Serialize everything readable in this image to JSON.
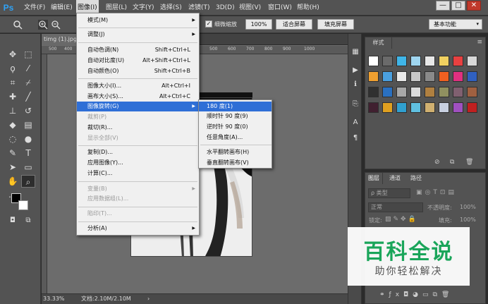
{
  "app": {
    "logo": "Ps"
  },
  "menubar": {
    "items": [
      "文件(F)",
      "编辑(E)",
      "图像(I)",
      "图层(L)",
      "文字(Y)",
      "选择(S)",
      "滤镜(T)",
      "3D(D)",
      "视图(V)",
      "窗口(W)",
      "帮助(H)"
    ],
    "active_index": 2,
    "window_controls": [
      "—",
      "□",
      "✕"
    ]
  },
  "options_bar": {
    "fine_scrub_label": "细微缩放",
    "zoom_value": "100%",
    "fit_screen_label": "适合屏幕",
    "fill_screen_label": "填充屏幕",
    "workspace_value": "基本功能"
  },
  "document": {
    "tab_title": "timg (1).jpg",
    "ruler_ticks": [
      "500",
      "400",
      "300",
      "200",
      "100",
      "0",
      "500",
      "600",
      "700",
      "800",
      "900",
      "1000"
    ],
    "zoom_status": "33.33%",
    "doc_info": "文档:2.10M/2.10M",
    "status_arrow": "›"
  },
  "image_menu": {
    "items": [
      {
        "label": "模式(M)",
        "shortcut": "",
        "submenu": true,
        "disabled": false
      },
      {
        "label": "调整(J)",
        "shortcut": "",
        "submenu": true,
        "disabled": false
      },
      {
        "label": "自动色调(N)",
        "shortcut": "Shift+Ctrl+L",
        "submenu": false,
        "disabled": false
      },
      {
        "label": "自动对比度(U)",
        "shortcut": "Alt+Shift+Ctrl+L",
        "submenu": false,
        "disabled": false
      },
      {
        "label": "自动颜色(O)",
        "shortcut": "Shift+Ctrl+B",
        "submenu": false,
        "disabled": false
      },
      {
        "label": "图像大小(I)...",
        "shortcut": "Alt+Ctrl+I",
        "submenu": false,
        "disabled": false
      },
      {
        "label": "画布大小(S)...",
        "shortcut": "Alt+Ctrl+C",
        "submenu": false,
        "disabled": false
      },
      {
        "label": "图像旋转(G)",
        "shortcut": "",
        "submenu": true,
        "disabled": false,
        "highlighted": true
      },
      {
        "label": "裁剪(P)",
        "shortcut": "",
        "submenu": false,
        "disabled": true
      },
      {
        "label": "裁切(R)...",
        "shortcut": "",
        "submenu": false,
        "disabled": false
      },
      {
        "label": "显示全部(V)",
        "shortcut": "",
        "submenu": false,
        "disabled": true
      },
      {
        "label": "复制(D)...",
        "shortcut": "",
        "submenu": false,
        "disabled": false
      },
      {
        "label": "应用图像(Y)...",
        "shortcut": "",
        "submenu": false,
        "disabled": false
      },
      {
        "label": "计算(C)...",
        "shortcut": "",
        "submenu": false,
        "disabled": false
      },
      {
        "label": "变量(B)",
        "shortcut": "",
        "submenu": true,
        "disabled": true
      },
      {
        "label": "应用数据组(L)...",
        "shortcut": "",
        "submenu": false,
        "disabled": true
      },
      {
        "label": "陷印(T)...",
        "shortcut": "",
        "submenu": false,
        "disabled": true
      },
      {
        "label": "分析(A)",
        "shortcut": "",
        "submenu": true,
        "disabled": false
      }
    ]
  },
  "rotate_submenu": {
    "items": [
      "180 度(1)",
      "顺时针 90 度(9)",
      "逆时针 90 度(0)",
      "任意角度(A)...",
      "水平翻转画布(H)",
      "垂直翻转画布(V)"
    ],
    "highlighted_index": 0
  },
  "styles_panel": {
    "tab_label": "样式",
    "swatch_colors": [
      "#ffffff",
      "#6a6a6a",
      "#3fb5e8",
      "#9fd6f0",
      "#e8e8e8",
      "#f0d060",
      "#e84040",
      "#d8d8d8",
      "#f0a030",
      "#4aa0e0",
      "#e8e8e8",
      "#c8c8c8",
      "#8a8a8a",
      "#f06020",
      "#e03080",
      "#3060c0",
      "#303030",
      "#2a70c0",
      "#a8a8a8",
      "#dcdcdc",
      "#b08040",
      "#909060",
      "#806070",
      "#a06040",
      "#402030",
      "#e0a020",
      "#30a0d0",
      "#60c0e0",
      "#d0b070",
      "#c8d0e0",
      "#a050c0",
      "#c02020"
    ]
  },
  "layers_panel": {
    "tabs": [
      "图层",
      "通道",
      "路径"
    ],
    "kind_filter": "ρ 类型",
    "blend_mode": "正常",
    "opacity_label": "不透明度:",
    "opacity_value": "100%",
    "lock_label": "锁定:",
    "fill_label": "填充:",
    "fill_value": "100%"
  },
  "watermark": {
    "title": "百科全说",
    "subtitle": "助你轻松解决"
  },
  "colors": {
    "accent": "#2f6fd6",
    "watermark_green": "#1aa55a",
    "chrome": "#535353"
  }
}
